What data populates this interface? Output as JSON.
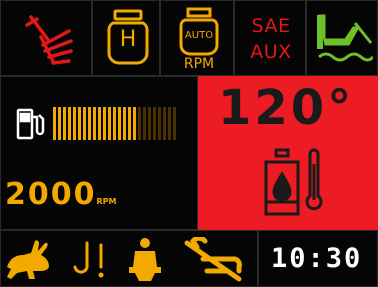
{
  "top_row": {
    "hitch_icon": "three-point-hitch-icon",
    "hold_icon": "engine-hold-icon",
    "hold_letter": "H",
    "auto_rpm_icon": "auto-rpm-icon",
    "auto_label": "AUTO",
    "rpm_label": "RPM",
    "sae_line1": "SAE",
    "sae_line2": "AUX",
    "implement_icon": "implement-float-icon"
  },
  "fuel": {
    "icon": "fuel-pump-icon",
    "level": 0.68
  },
  "engine": {
    "rpm_value": "2000",
    "rpm_unit": "RPM"
  },
  "coolant": {
    "temperature": "120°",
    "icon": "coolant-temperature-icon",
    "alert_color": "#ed1c24"
  },
  "bottom_row": {
    "rabbit_icon": "rabbit-speed-icon",
    "warning_icon": "hook-warning-icon",
    "seat_icon": "operator-seat-icon",
    "brake_icon": "parking-brake-off-icon",
    "clock": "10:30"
  },
  "colors": {
    "amber": "#f2a900",
    "red": "#e01818",
    "green": "#6fc02a",
    "alert": "#ed1c24"
  }
}
